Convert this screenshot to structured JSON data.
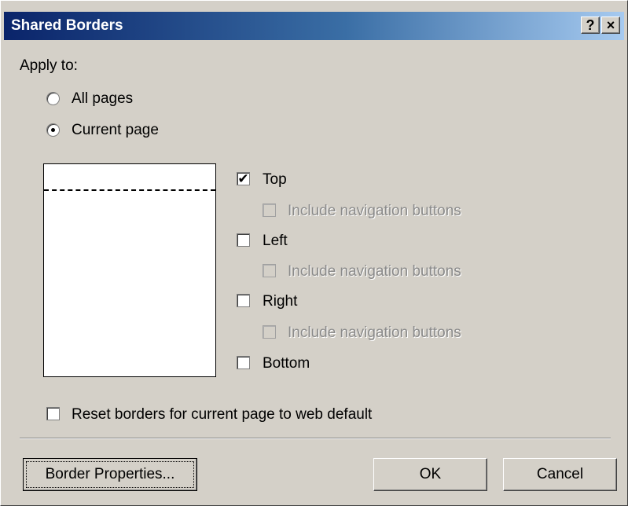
{
  "title": "Shared Borders",
  "title_buttons": {
    "help": "?",
    "close": "×"
  },
  "apply_to": {
    "label": "Apply to:",
    "options": [
      {
        "label": "All pages",
        "selected": false
      },
      {
        "label": "Current page",
        "selected": true
      }
    ]
  },
  "borders": {
    "top": {
      "label": "Top",
      "checked": true,
      "nav_label": "Include navigation buttons",
      "nav_checked": false
    },
    "left": {
      "label": "Left",
      "checked": false,
      "nav_label": "Include navigation buttons",
      "nav_checked": false
    },
    "right": {
      "label": "Right",
      "checked": false,
      "nav_label": "Include navigation buttons",
      "nav_checked": false
    },
    "bottom": {
      "label": "Bottom",
      "checked": false
    }
  },
  "reset": {
    "label": "Reset borders for current page to web default",
    "checked": false
  },
  "buttons": {
    "border_properties": "Border Properties...",
    "ok": "OK",
    "cancel": "Cancel"
  }
}
